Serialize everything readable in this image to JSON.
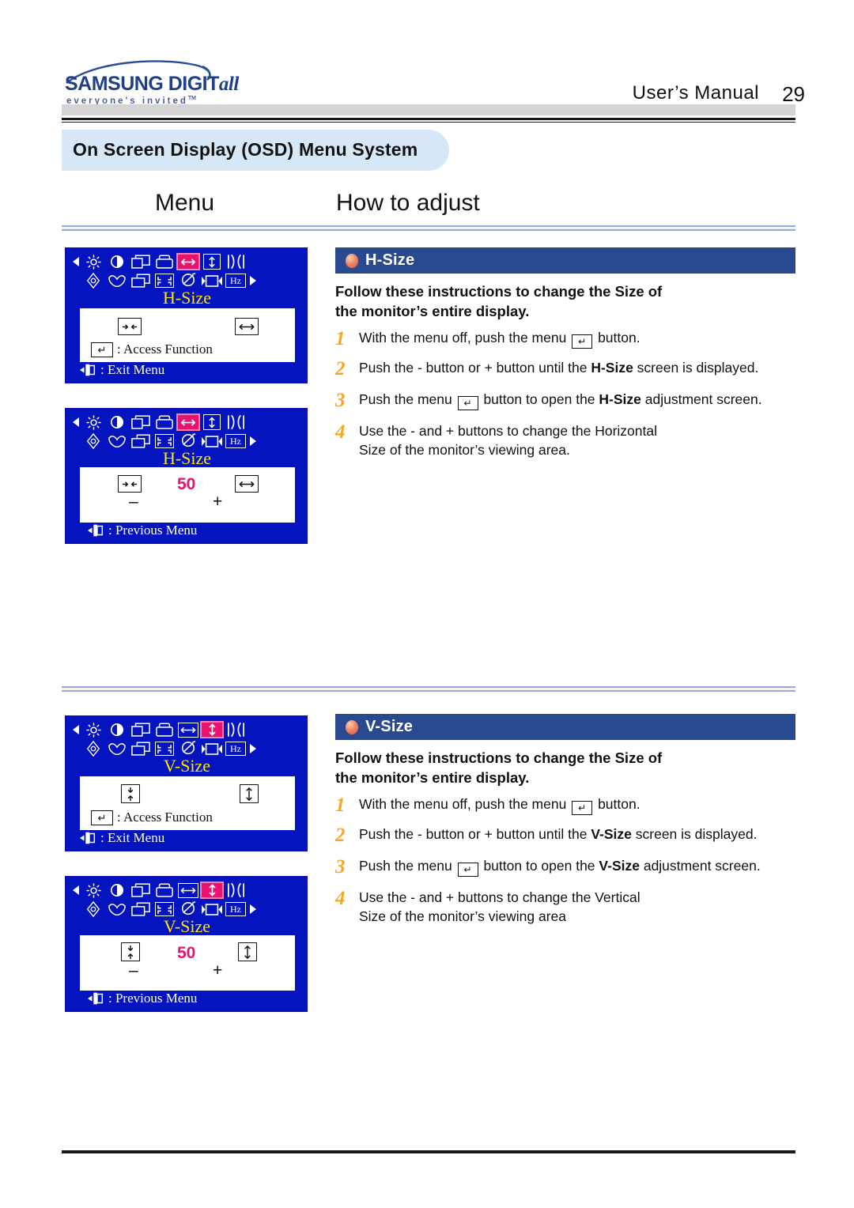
{
  "header": {
    "logo_brand": "SAMSUNG DIGIT",
    "logo_brand_italic": "all",
    "logo_tagline": "everyone's invited",
    "logo_tm": "TM",
    "manual_label": "User’s Manual",
    "page_number": "29"
  },
  "section": {
    "title": "On Screen Display (OSD) Menu System"
  },
  "columns": {
    "menu": "Menu",
    "how_to_adjust": "How to adjust"
  },
  "osd_panels": [
    {
      "id": "h-size-menu",
      "title": "H-Size",
      "highlight_icon": "h-size-icon",
      "value": null,
      "minus": null,
      "plus": null,
      "access_label": ": Access Function",
      "foot_label": ": Exit Menu",
      "left_icon": "h-size-narrow-icon",
      "right_icon": "h-size-wide-icon"
    },
    {
      "id": "h-size-adjust",
      "title": "H-Size",
      "highlight_icon": "h-size-icon",
      "value": "50",
      "minus": "–",
      "plus": "+",
      "access_label": null,
      "foot_label": ": Previous Menu",
      "left_icon": "h-size-narrow-icon",
      "right_icon": "h-size-wide-icon"
    },
    {
      "id": "v-size-menu",
      "title": "V-Size",
      "highlight_icon": "v-size-icon",
      "value": null,
      "minus": null,
      "plus": null,
      "access_label": ": Access Function",
      "foot_label": ": Exit Menu",
      "left_icon": "v-size-narrow-icon",
      "right_icon": "v-size-tall-icon"
    },
    {
      "id": "v-size-adjust",
      "title": "V-Size",
      "highlight_icon": "v-size-icon",
      "value": "50",
      "minus": "–",
      "plus": "+",
      "access_label": null,
      "foot_label": ": Previous Menu",
      "left_icon": "v-size-narrow-icon",
      "right_icon": "v-size-tall-icon"
    }
  ],
  "osd_icon_names": [
    "brightness-icon",
    "contrast-icon",
    "h-position-icon",
    "v-position-icon",
    "h-size-icon",
    "v-size-icon",
    "pincushion-icon",
    "rotation-icon",
    "zoom-icon",
    "moire-icon",
    "degauss-icon",
    "trapezoid-icon",
    "parallelogram-icon",
    "frequency-hz-icon"
  ],
  "instructions": [
    {
      "id": "h-size",
      "heading": "H-Size",
      "lead_line1": "Follow these instructions to change the  Size of",
      "lead_line2": "the monitor’s entire display.",
      "steps": [
        {
          "num": "1",
          "pre": "With the menu off, push the menu ",
          "key": "↵",
          "post": " button.",
          "bold": "",
          "tail": ""
        },
        {
          "num": "2",
          "pre": "Push the  - button or  + button until the ",
          "key": null,
          "bold": "H-Size",
          "post": "  screen is displayed.",
          "tail": ""
        },
        {
          "num": "3",
          "pre": "Push the menu ",
          "key": "↵",
          "post": " button to open the ",
          "bold": "H-Size",
          "tail": " adjustment screen."
        },
        {
          "num": "4",
          "pre": "Use the  - and  + buttons to change the Horizontal",
          "key": null,
          "post": "",
          "bold": "",
          "tail": "Size of the monitor’s viewing area."
        }
      ]
    },
    {
      "id": "v-size",
      "heading": "V-Size",
      "lead_line1": "Follow these instructions to change the  Size of",
      "lead_line2": "the monitor’s entire display.",
      "steps": [
        {
          "num": "1",
          "pre": "With the menu off, push the menu ",
          "key": "↵",
          "post": " button.",
          "bold": "",
          "tail": ""
        },
        {
          "num": "2",
          "pre": "Push the  - button or  + button until the ",
          "key": null,
          "bold": "V-Size",
          "post": " screen is displayed.",
          "tail": ""
        },
        {
          "num": "3",
          "pre": "Push the menu ",
          "key": "↵",
          "post": " button to open the ",
          "bold": "V-Size",
          "tail": " adjustment screen."
        },
        {
          "num": "4",
          "pre": "Use the  - and  + buttons to change the Vertical",
          "key": null,
          "post": "",
          "bold": "",
          "tail": "Size of the monitor’s viewing area"
        }
      ]
    }
  ],
  "colors": {
    "osd_blue": "#0415c0",
    "osd_title_yellow": "#ffe400",
    "highlight_magenta": "#e8136e",
    "heading_navy": "#2a4a8f",
    "section_bg": "#d6e8f7",
    "step_number_orange": "#f5a623",
    "brand_blue": "#1f3f88"
  }
}
